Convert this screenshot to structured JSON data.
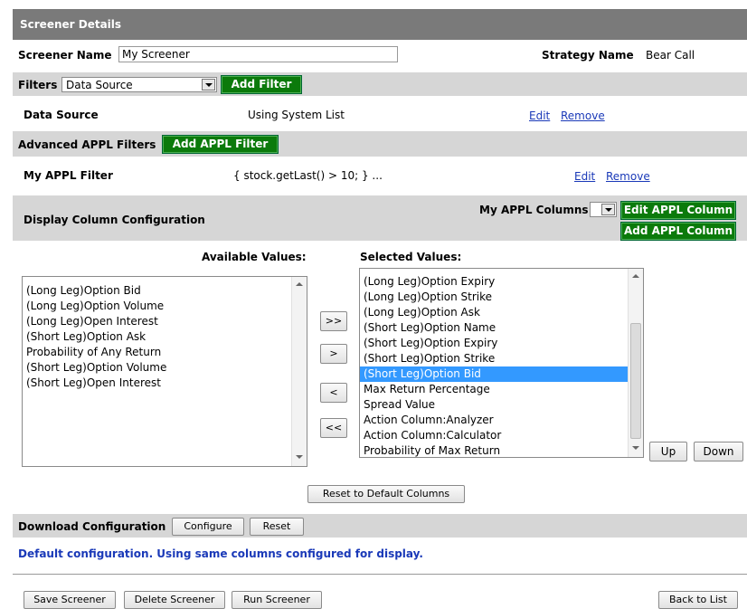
{
  "header": {
    "title": "Screener Details"
  },
  "screener": {
    "name_label": "Screener Name",
    "name_value": "My Screener",
    "strategy_label": "Strategy Name",
    "strategy_value": "Bear Call"
  },
  "filters": {
    "label": "Filters",
    "select_value": "Data Source",
    "add_button": "Add Filter"
  },
  "data_source_row": {
    "name": "Data Source",
    "value": "Using System List",
    "edit": "Edit",
    "remove": "Remove"
  },
  "advanced": {
    "label": "Advanced APPL Filters",
    "add_button": "Add APPL Filter"
  },
  "appl_filter_row": {
    "name": "My APPL Filter",
    "value": "{ stock.getLast() > 10; } ...",
    "edit": "Edit",
    "remove": "Remove"
  },
  "display": {
    "label": "Display Column Configuration",
    "appl_columns_label": "My APPL Columns",
    "edit_button": "Edit APPL Column",
    "add_button": "Add APPL Column"
  },
  "available": {
    "header": "Available Values:",
    "items": [
      "(Long Leg)Option Bid",
      "(Long Leg)Option Volume",
      "(Long Leg)Open Interest",
      "(Short Leg)Option Ask",
      "Probability of Any Return",
      "(Short Leg)Option Volume",
      "(Short Leg)Open Interest"
    ]
  },
  "selected": {
    "header": "Selected Values:",
    "items": [
      "(Long Leg)Option Expiry",
      "(Long Leg)Option Strike",
      "(Long Leg)Option Ask",
      "(Short Leg)Option Name",
      "(Short Leg)Option Expiry",
      "(Short Leg)Option Strike",
      "(Short Leg)Option Bid",
      "Max Return Percentage",
      "Spread Value",
      "Action Column:Analyzer",
      "Action Column:Calculator",
      "Probability of Max Return"
    ],
    "selected_item": "(Short Leg)Option Bid"
  },
  "move_buttons": {
    "add_all": ">>",
    "add": ">",
    "remove": "<",
    "remove_all": "<<"
  },
  "order_buttons": {
    "up": "Up",
    "down": "Down"
  },
  "reset_columns": "Reset to Default Columns",
  "download": {
    "label": "Download Configuration",
    "configure": "Configure",
    "reset": "Reset",
    "note": "Default configuration. Using same columns configured for display."
  },
  "footer": {
    "save": "Save Screener",
    "delete": "Delete Screener",
    "run": "Run Screener",
    "back": "Back to List"
  },
  "colors": {
    "header_bg": "#7a7a7a",
    "section_bg": "#d6d6d6",
    "green": "#0b7a0b",
    "link": "#1a39b8",
    "selection": "#3399ff"
  }
}
